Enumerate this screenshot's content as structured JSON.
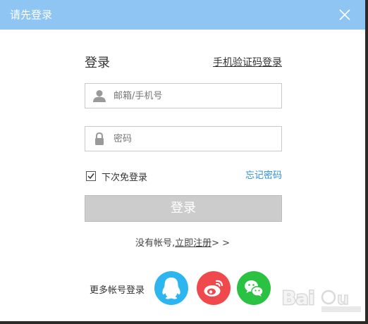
{
  "dialog": {
    "title": "请先登录",
    "close_icon": "close-icon"
  },
  "login": {
    "heading": "登录",
    "sms_login_link": "手机验证码登录",
    "email_placeholder": "邮箱/手机号",
    "password_placeholder": "密码",
    "remember_label": "下次免登录",
    "remember_checked": true,
    "forgot_link": "忘记密码",
    "submit_label": "登录"
  },
  "register": {
    "prefix": "没有帐号,",
    "link": "立即注册",
    "suffix": "> >"
  },
  "more_accounts": {
    "label": "更多帐号登录",
    "providers": [
      {
        "name": "QQ",
        "icon": "qq-icon",
        "color": "#2db5f0"
      },
      {
        "name": "Weibo",
        "icon": "weibo-icon",
        "color": "#f0494d"
      },
      {
        "name": "WeChat",
        "icon": "wechat-icon",
        "color": "#2bc142"
      }
    ]
  },
  "colors": {
    "titlebar": "#8ec5f2",
    "link_blue": "#2a8fd8",
    "button_disabled": "#cccccc"
  }
}
